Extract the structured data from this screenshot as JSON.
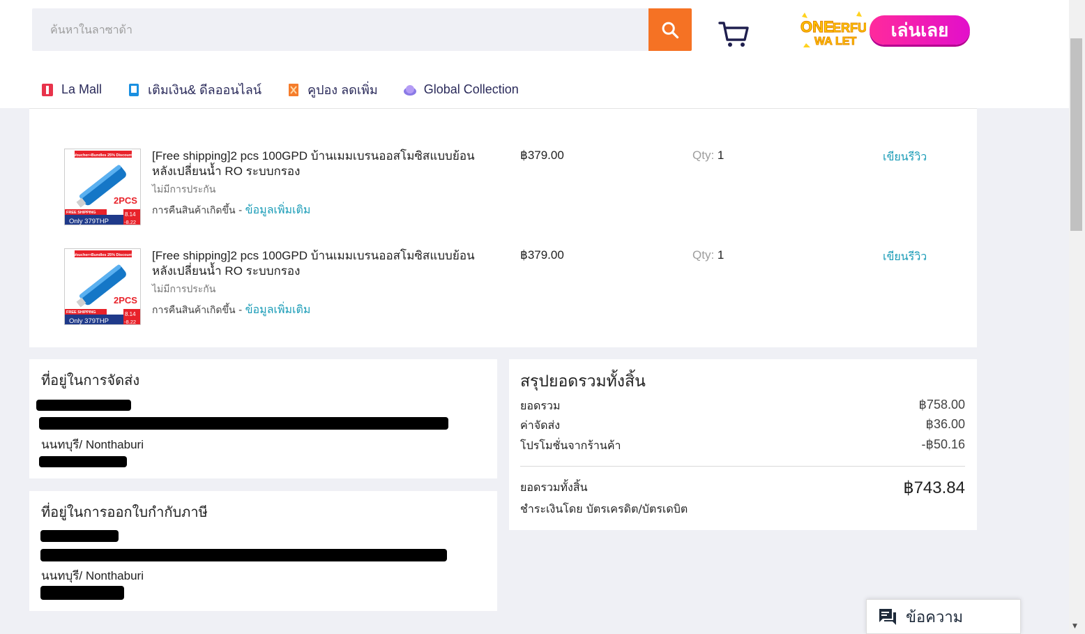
{
  "header": {
    "search_placeholder": "ค้นหาในลาซาด้า",
    "play_label": "เล่นเลย",
    "promo_logo_text": "ONEDERFUL WALLET"
  },
  "nav": [
    {
      "label": "La  Mall",
      "icon": "lazmall-icon"
    },
    {
      "label": "เติมเงิน& ดีลออนไลน์",
      "icon": "phone-topup-icon"
    },
    {
      "label": "คูปอง ลดเพิ่ม",
      "icon": "coupon-icon"
    },
    {
      "label": "Global Collection",
      "icon": "globe-icon"
    }
  ],
  "items": [
    {
      "title": "[Free shipping]2 pcs 100GPD บ้านเมมเบรนออสโมซิสแบบย้อนหลังเปลี่ยนน้ำ RO ระบบกรอง",
      "warranty": "ไม่มีการประกัน",
      "returns_text": "การคืนสินค้าเกิดขึ้น - ",
      "returns_link": "ข้อมูลเพิ่มเติม",
      "price": "฿379.00",
      "qty_label": "Qty:",
      "qty": "1",
      "review_label": "เขียนรีวิว",
      "thumb": {
        "badge": "Voucher+Bundles 25% Discount",
        "pcs": "2PCS",
        "ship": "FREE SHIPPING",
        "only": "Only 379THP",
        "date1": "8.14",
        "date2": "-8.22"
      }
    },
    {
      "title": "[Free shipping]2 pcs 100GPD บ้านเมมเบรนออสโมซิสแบบย้อนหลังเปลี่ยนน้ำ RO ระบบกรอง",
      "warranty": "ไม่มีการประกัน",
      "returns_text": "การคืนสินค้าเกิดขึ้น - ",
      "returns_link": "ข้อมูลเพิ่มเติม",
      "price": "฿379.00",
      "qty_label": "Qty:",
      "qty": "1",
      "review_label": "เขียนรีวิว",
      "thumb": {
        "badge": "Voucher+Bundles 25% Discount",
        "pcs": "2PCS",
        "ship": "FREE SHIPPING",
        "only": "Only 379THP",
        "date1": "8.14",
        "date2": "-8.22"
      }
    }
  ],
  "shipping": {
    "title": "ที่อยู่ในการจัดส่ง",
    "city": "นนทบุรี/ Nonthaburi"
  },
  "billing": {
    "title": "ที่อยู่ในการออกใบกำกับภาษี",
    "city": "นนทบุรี/ Nonthaburi"
  },
  "summary": {
    "title": "สรุปยอดรวมทั้งสิ้น",
    "subtotal_label": "ยอดรวม",
    "subtotal": "฿758.00",
    "shipping_label": "ค่าจัดส่ง",
    "shipping": "฿36.00",
    "promo_label": "โปรโมชั่นจากร้านค้า",
    "promo": "-฿50.16",
    "total_label": "ยอดรวมทั้งสิ้น",
    "total": "฿743.84",
    "payment": "ชำระเงินโดย บัตรเครดิต/บัตรเดบิต"
  },
  "chat": {
    "label": "ข้อความ"
  },
  "colors": {
    "accent": "#f57224",
    "link": "#1a9cb7",
    "play": "#ff2a9c"
  }
}
